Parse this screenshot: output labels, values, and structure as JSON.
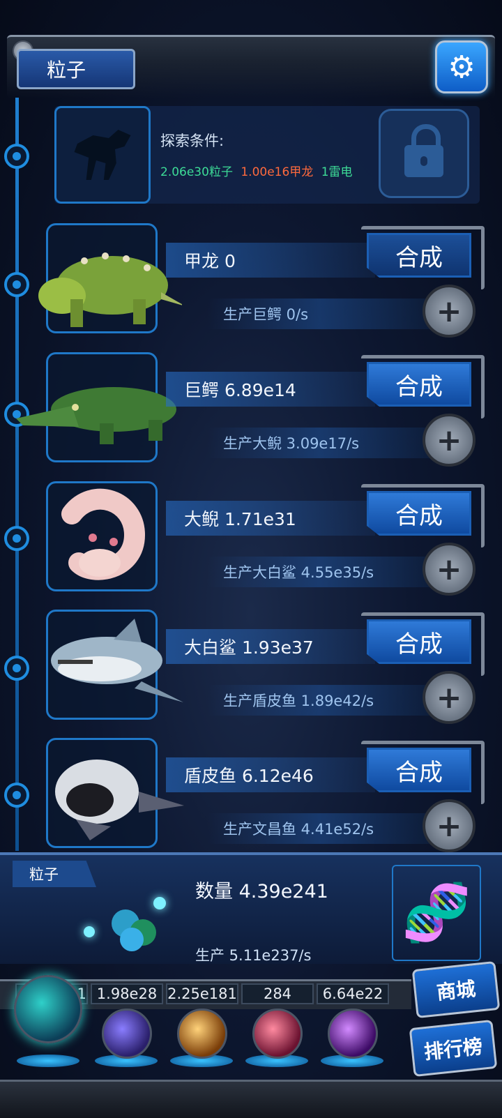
{
  "header": {
    "title": "粒子"
  },
  "locked": {
    "explore_label": "探索条件:",
    "conditions": [
      {
        "text": "2.06e30粒子",
        "color": "#3ddc97"
      },
      {
        "text": "1.00e16甲龙",
        "color": "#ff6a3d"
      },
      {
        "text": "1雷电",
        "color": "#3ddc97"
      }
    ]
  },
  "creatures": [
    {
      "name": "甲龙 0",
      "production": "生产巨鳄 0/s",
      "synth_label": "合成"
    },
    {
      "name": "巨鳄 6.89e14",
      "production": "生产大鲵 3.09e17/s",
      "synth_label": "合成"
    },
    {
      "name": "大鲵 1.71e31",
      "production": "生产大白鲨 4.55e35/s",
      "synth_label": "合成"
    },
    {
      "name": "大白鲨 1.93e37",
      "production": "生产盾皮鱼 1.89e42/s",
      "synth_label": "合成"
    },
    {
      "name": "盾皮鱼 6.12e46",
      "production": "生产文昌鱼 4.41e52/s",
      "synth_label": "合成"
    }
  ],
  "particle_panel": {
    "tag": "粒子",
    "count": "数量 4.39e241",
    "production": "生产 5.11e237/s"
  },
  "resources": [
    {
      "value": "4.39e241",
      "orb": "particle-orb",
      "color": "#2fd0c9"
    },
    {
      "value": "1.98e28",
      "orb": "lightning-orb",
      "color": "#6b5cff"
    },
    {
      "value": "2.25e181",
      "orb": "fire-orb",
      "color": "#ffb23d"
    },
    {
      "value": "284",
      "orb": "brain-orb",
      "color": "#ff5a7a"
    },
    {
      "value": "6.64e22",
      "orb": "vortex-orb",
      "color": "#b04dff"
    }
  ],
  "side_buttons": {
    "shop": "商城",
    "rank": "排行榜"
  }
}
